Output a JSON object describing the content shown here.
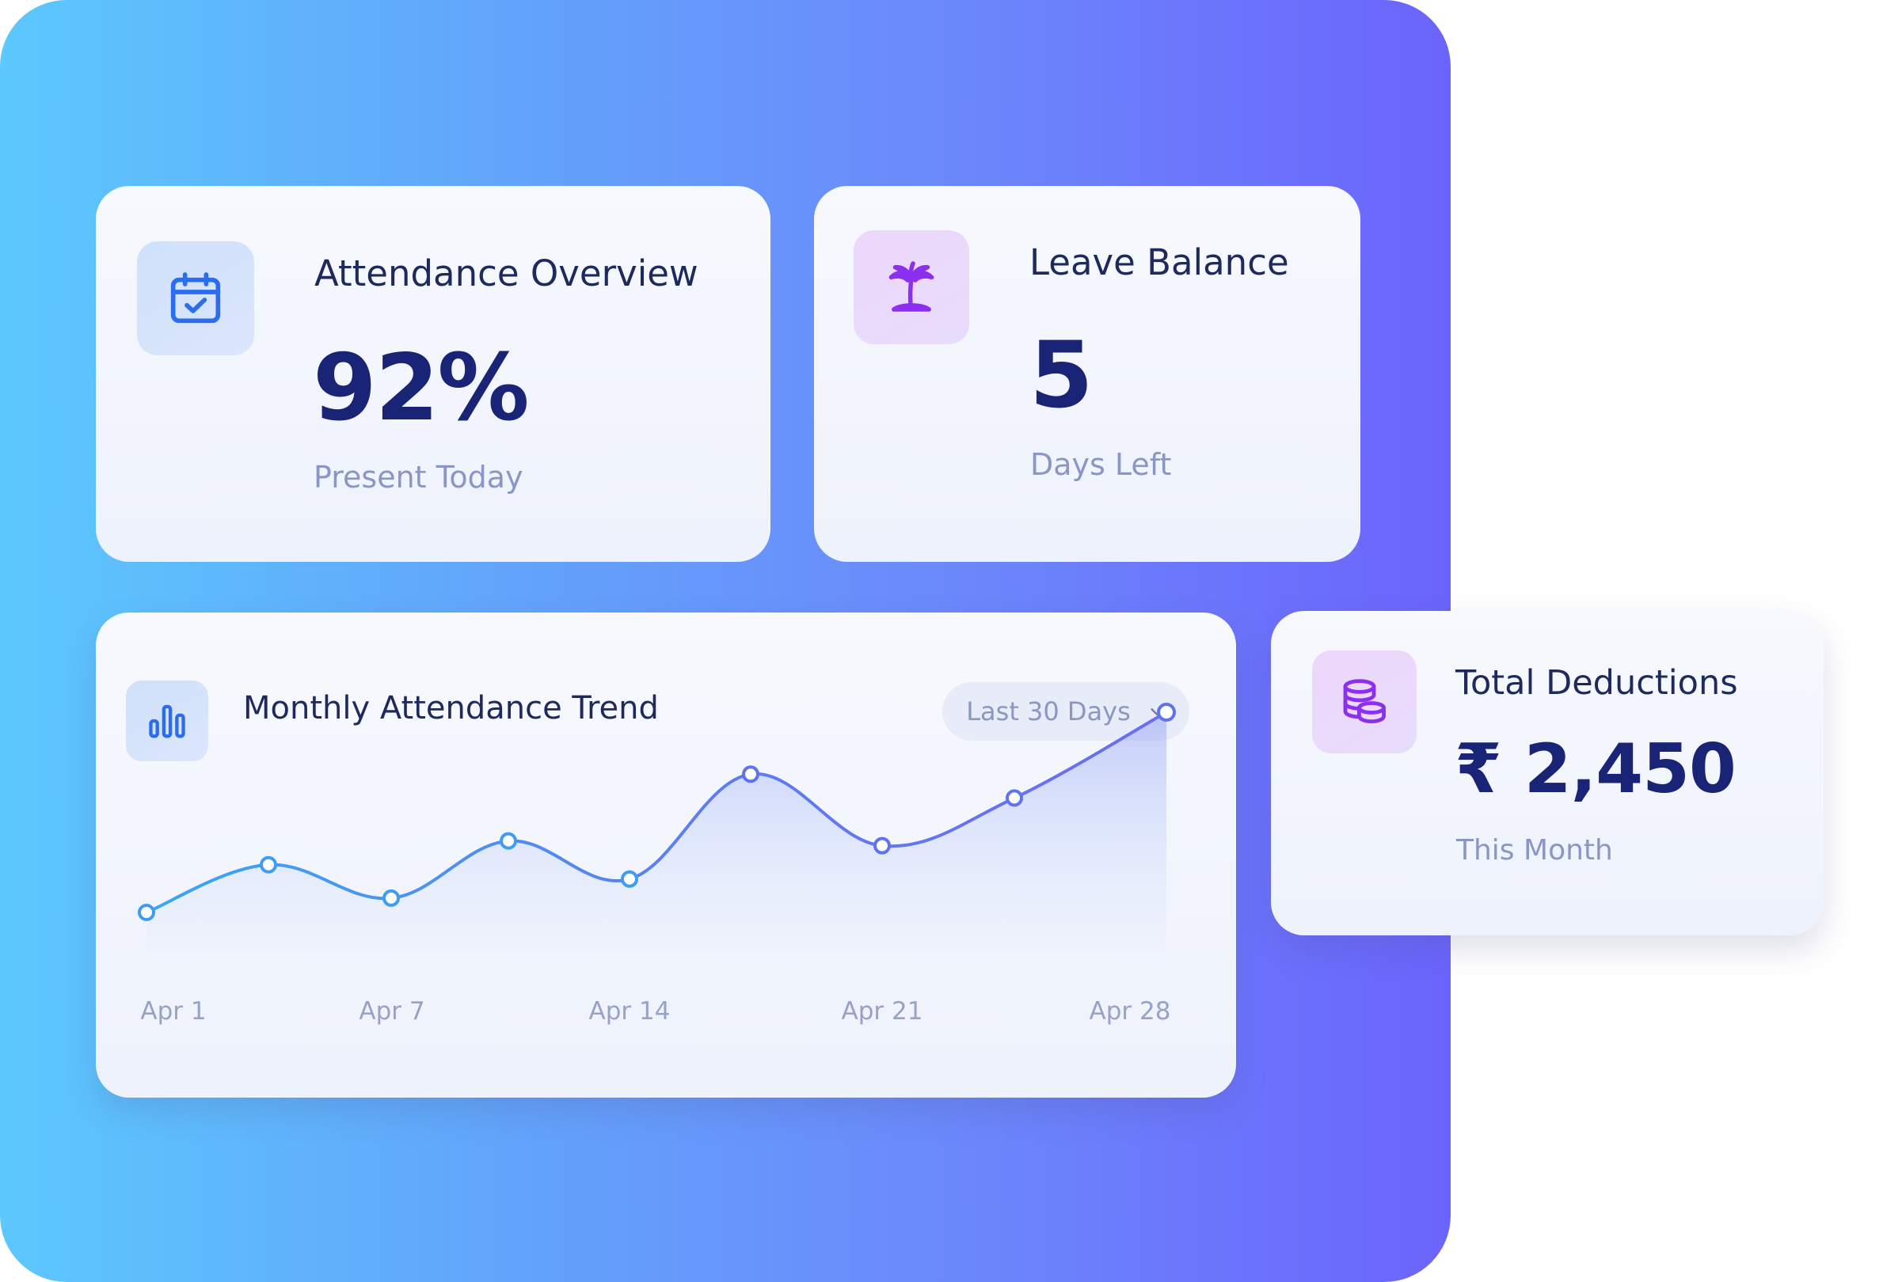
{
  "colors": {
    "gradient_start": "#5cc8fd",
    "gradient_end": "#6b64fc",
    "accent_blue": "#2a6df0",
    "accent_violet": "#8c2ff0",
    "value_navy": "#1a2476"
  },
  "attendance": {
    "icon": "calendar-check-icon",
    "title": "Attendance Overview",
    "value": "92%",
    "caption": "Present Today"
  },
  "leave": {
    "icon": "palm-tree-icon",
    "title": "Leave Balance",
    "value": "5",
    "caption": "Days Left"
  },
  "trend": {
    "icon": "bar-chart-icon",
    "title": "Monthly Attendance Trend",
    "range_selector": "Last 30 Days"
  },
  "deductions": {
    "icon": "coins-stack-icon",
    "title": "Total Deductions",
    "value": "₹ 2,450",
    "caption": "This Month"
  },
  "chart_data": {
    "type": "area",
    "title": "",
    "xlabel": "",
    "ylabel": "",
    "x_tick_labels": [
      "Apr 1",
      "Apr 7",
      "Apr 14",
      "Apr 21",
      "Apr 28"
    ],
    "x": [
      "Apr 1",
      "Apr 4",
      "Apr 7",
      "Apr 10",
      "Apr 14",
      "Apr 17",
      "Apr 21",
      "Apr 24",
      "Apr 28"
    ],
    "series": [
      {
        "values": [
          20,
          30,
          23,
          35,
          27,
          49,
          34,
          44,
          62
        ]
      }
    ],
    "ylim": [
      0,
      100
    ],
    "grid": false,
    "legend": "none"
  }
}
